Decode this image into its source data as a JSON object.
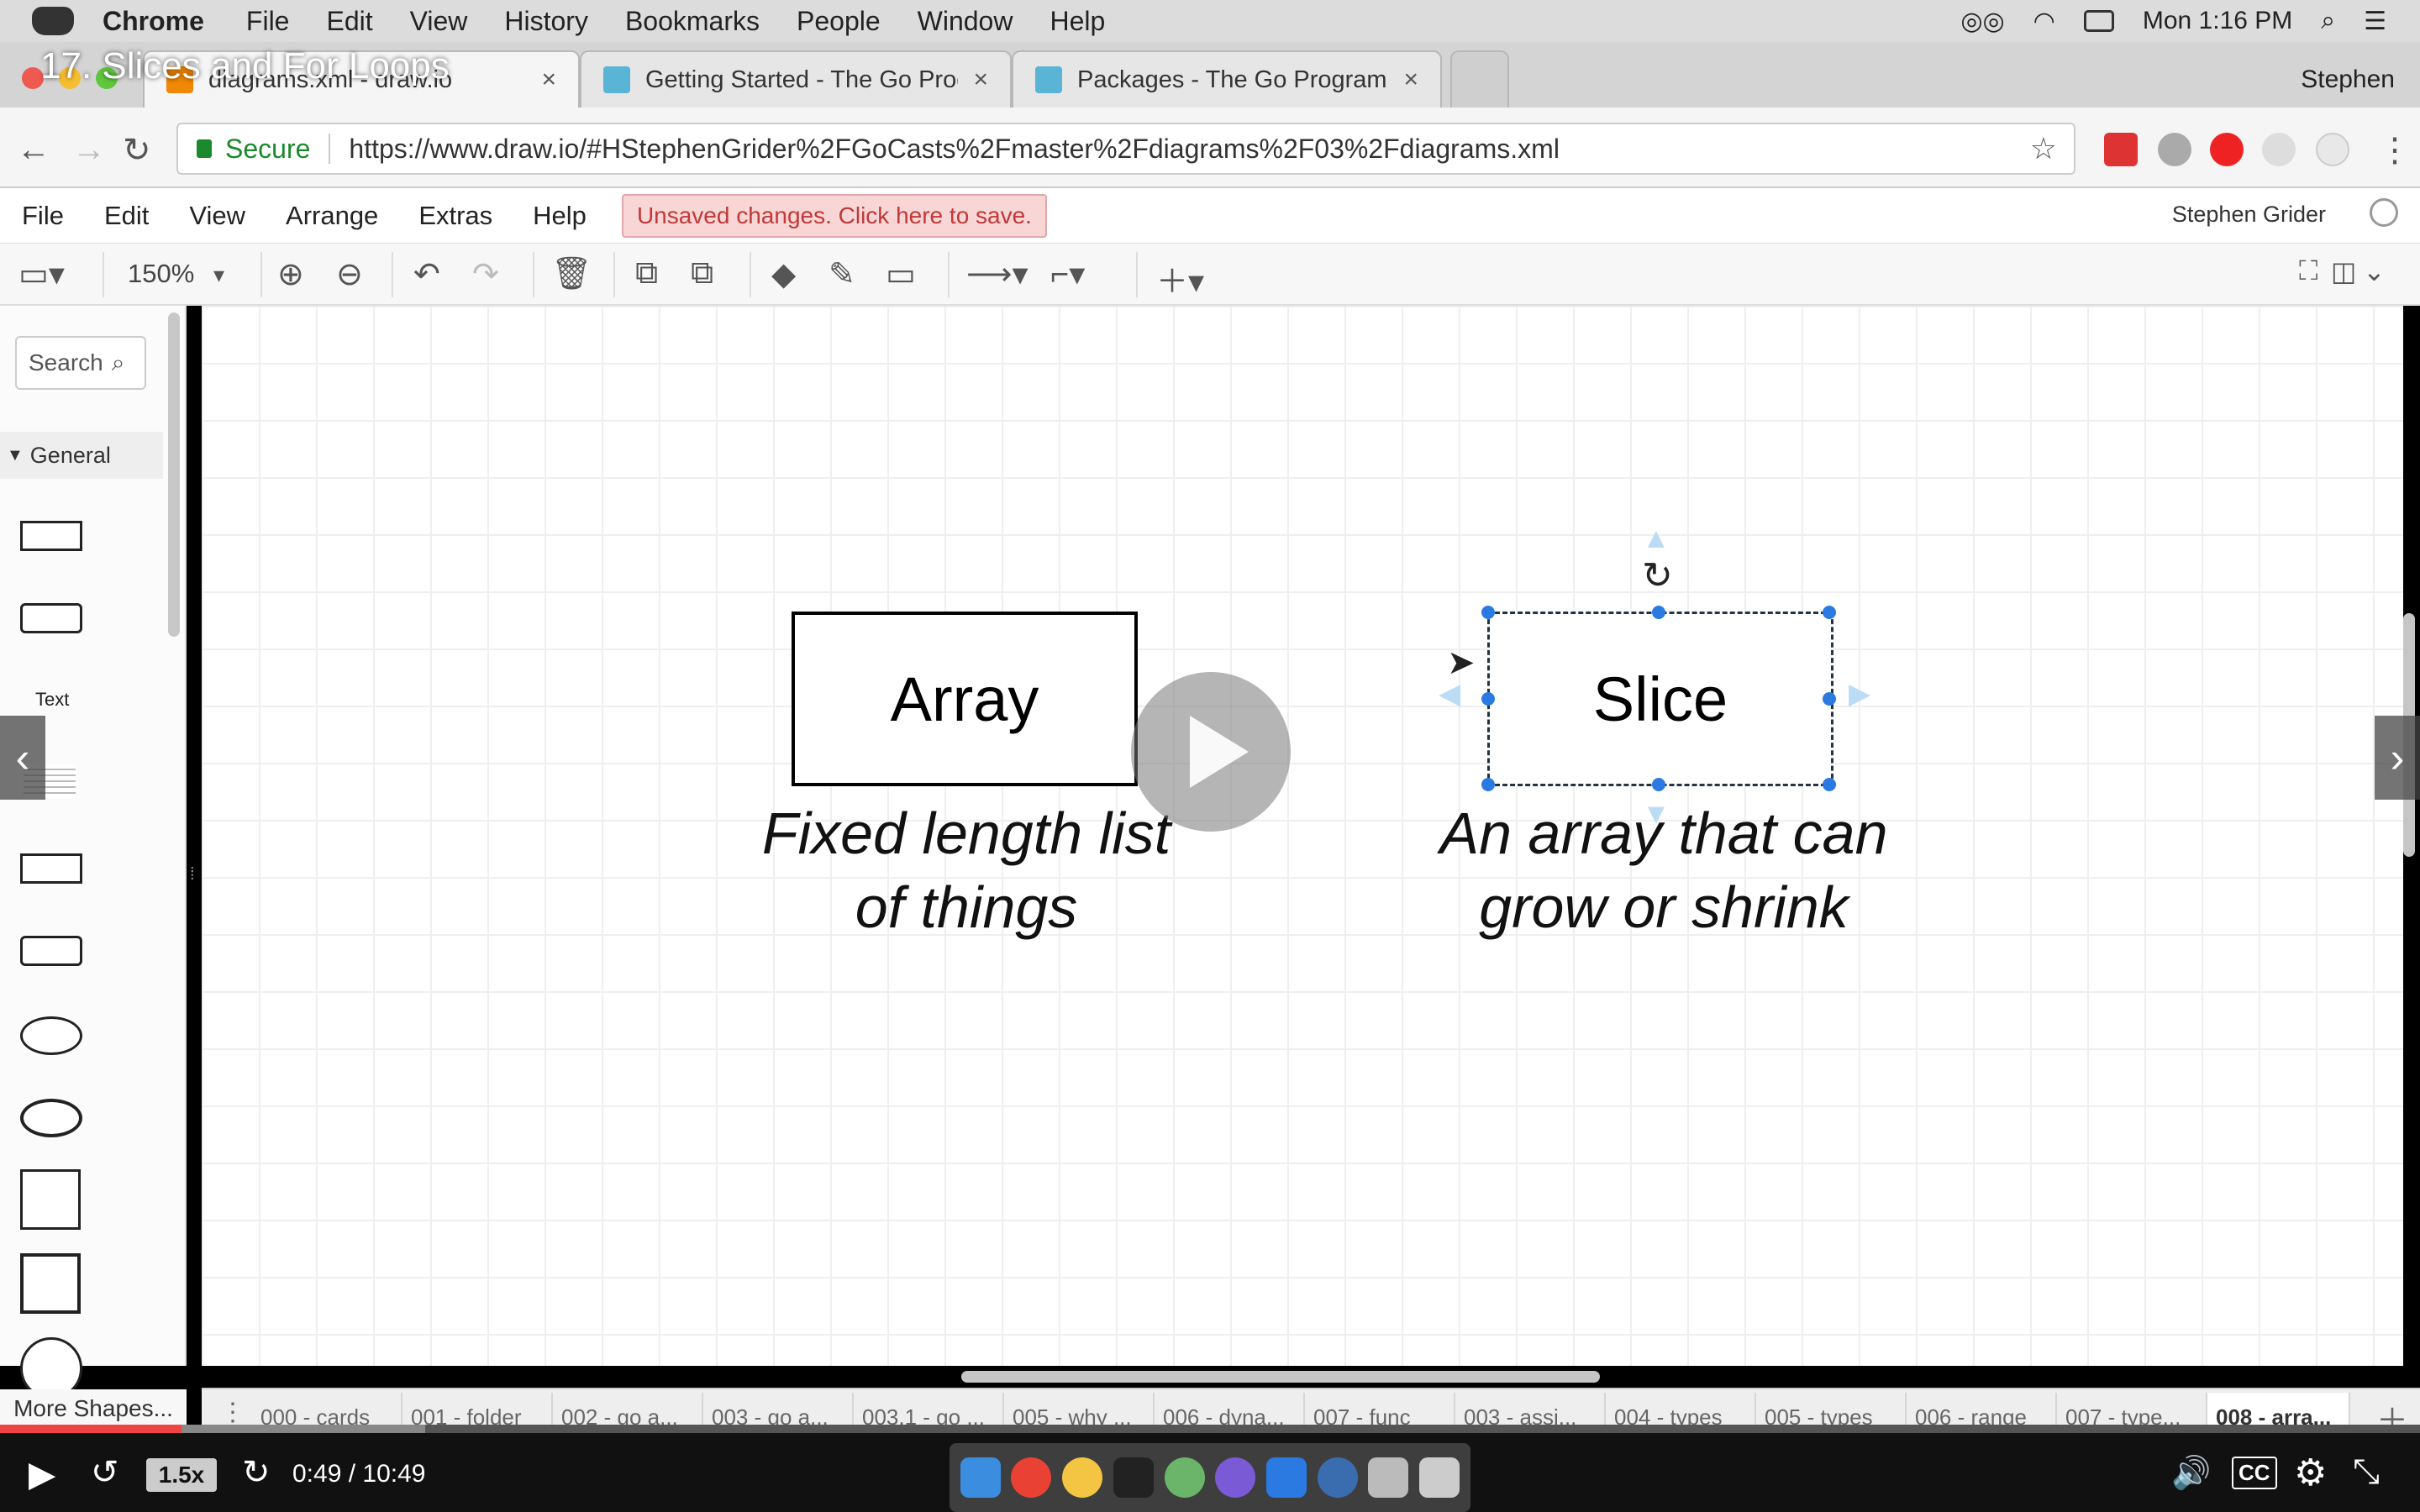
{
  "os_menubar": {
    "app_name": "Chrome",
    "items": [
      "File",
      "Edit",
      "View",
      "History",
      "Bookmarks",
      "People",
      "Window",
      "Help"
    ],
    "clock": "Mon 1:16 PM"
  },
  "video": {
    "title": "17. Slices and For Loops",
    "speed": "1.5x",
    "time": "0:49 / 10:49",
    "progress": 0.075
  },
  "browser": {
    "tabs": [
      {
        "label": "diagrams.xml - draw.io",
        "close": "×"
      },
      {
        "label": "Getting Started - The Go Prog",
        "close": "×"
      },
      {
        "label": "Packages - The Go Programmi",
        "close": "×"
      }
    ],
    "profile": "Stephen",
    "secure_label": "Secure",
    "url": "https://www.draw.io/#HStephenGrider%2FGoCasts%2Fmaster%2Fdiagrams%2F03%2Fdiagrams.xml"
  },
  "drawio": {
    "menu": [
      "File",
      "Edit",
      "View",
      "Arrange",
      "Extras",
      "Help"
    ],
    "unsaved": "Unsaved changes. Click here to save.",
    "user": "Stephen Grider",
    "zoom": "150%",
    "search_placeholder": "Search",
    "general_label": "General",
    "text_shape_label": "Text",
    "more_shapes": "More Shapes...",
    "page_tabs": [
      "000 - cards",
      "001 - folder",
      "002 - go a...",
      "003 - go a...",
      "003.1 - go ...",
      "005 - why ...",
      "006 - dyna...",
      "007 - func",
      "003 - assi...",
      "004 - types",
      "005 - types",
      "006 - range",
      "007 - type...",
      "008 - arra..."
    ],
    "active_page_index": 13
  },
  "diagram": {
    "array_box": "Array",
    "array_caption_line1": "Fixed length list",
    "array_caption_line2": "of things",
    "slice_box": "Slice",
    "slice_caption_line1": "An array that can",
    "slice_caption_line2": "grow or shrink"
  }
}
